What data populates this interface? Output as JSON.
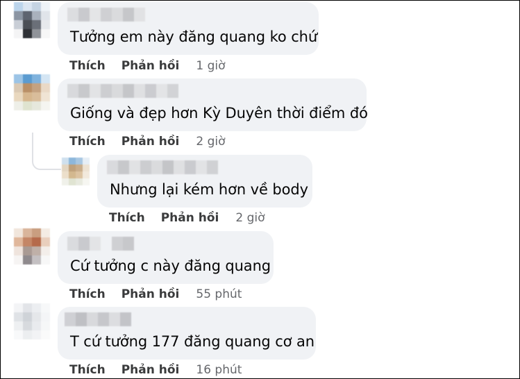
{
  "comments": [
    {
      "text": "Tưởng em này đăng quang ko chứ",
      "like": "Thích",
      "reply": "Phản hồi",
      "time": "1 giờ"
    },
    {
      "text": "Giống và đẹp hơn Kỳ Duyên thời điểm đó",
      "like": "Thích",
      "reply": "Phản hồi",
      "time": "2 giờ"
    },
    {
      "text": "Nhưng lại kém hơn về body",
      "like": "Thích",
      "reply": "Phản hồi",
      "time": "2 giờ"
    },
    {
      "text": "Cứ tưởng c này đăng quang",
      "like": "Thích",
      "reply": "Phản hồi",
      "time": "55 phút"
    },
    {
      "text": "T cứ tưởng 177 đăng quang cơ an",
      "like": "Thích",
      "reply": "Phản hồi",
      "time": "16 phút"
    }
  ]
}
